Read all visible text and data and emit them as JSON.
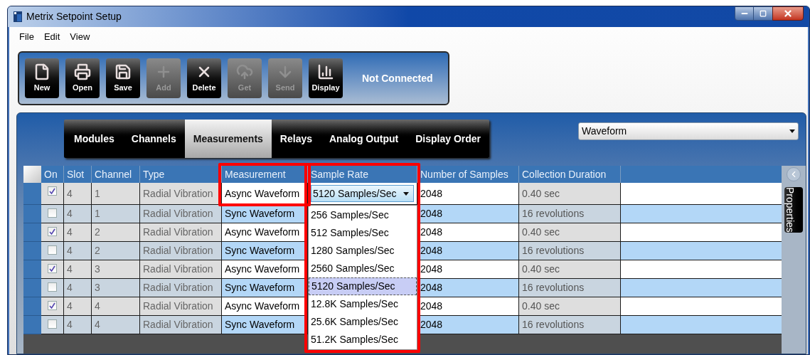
{
  "window": {
    "title": "Metrix Setpoint Setup"
  },
  "menu": [
    "File",
    "Edit",
    "View"
  ],
  "toolbar": {
    "buttons": [
      {
        "kind": "new",
        "label": "New",
        "disabled": false
      },
      {
        "kind": "open",
        "label": "Open",
        "disabled": false
      },
      {
        "kind": "save",
        "label": "Save",
        "disabled": false
      },
      {
        "kind": "add",
        "label": "Add",
        "disabled": true
      },
      {
        "kind": "delete",
        "label": "Delete",
        "disabled": false
      },
      {
        "kind": "get",
        "label": "Get",
        "disabled": true
      },
      {
        "kind": "send",
        "label": "Send",
        "disabled": true
      },
      {
        "kind": "display",
        "label": "Display",
        "disabled": false
      }
    ],
    "status": "Not Connected"
  },
  "tabs": [
    {
      "label": "Modules",
      "selected": false
    },
    {
      "label": "Channels",
      "selected": false
    },
    {
      "label": "Measurements",
      "selected": true
    },
    {
      "label": "Relays",
      "selected": false
    },
    {
      "label": "Analog Output",
      "selected": false
    },
    {
      "label": "Display Order",
      "selected": false
    }
  ],
  "filter": {
    "value": "Waveform"
  },
  "table": {
    "columns": [
      {
        "label": "On",
        "highlighted": false
      },
      {
        "label": "Slot",
        "highlighted": false
      },
      {
        "label": "Channel",
        "highlighted": false
      },
      {
        "label": "Type",
        "highlighted": false
      },
      {
        "label": "Measurement",
        "highlighted": true
      },
      {
        "label": "Sample Rate",
        "highlighted": true
      },
      {
        "label": "Number of Samples",
        "highlighted": false
      },
      {
        "label": "Collection Duration",
        "highlighted": false
      }
    ],
    "rows": [
      {
        "on": true,
        "slot": "4",
        "channel": "1",
        "type": "Radial Vibration",
        "measurement": "Async Waveform",
        "sample_rate": "5120 Samples/Sec",
        "samples": "2048",
        "duration": "0.40 sec"
      },
      {
        "on": false,
        "slot": "4",
        "channel": "1",
        "type": "Radial Vibration",
        "measurement": "Sync Waveform",
        "samples": "2048",
        "duration": "16 revolutions"
      },
      {
        "on": true,
        "slot": "4",
        "channel": "2",
        "type": "Radial Vibration",
        "measurement": "Async Waveform",
        "samples": "2048",
        "duration": "0.40 sec"
      },
      {
        "on": false,
        "slot": "4",
        "channel": "2",
        "type": "Radial Vibration",
        "measurement": "Sync Waveform",
        "samples": "2048",
        "duration": "16 revolutions"
      },
      {
        "on": true,
        "slot": "4",
        "channel": "3",
        "type": "Radial Vibration",
        "measurement": "Async Waveform",
        "samples": "2048",
        "duration": "0.40 sec"
      },
      {
        "on": false,
        "slot": "4",
        "channel": "3",
        "type": "Radial Vibration",
        "measurement": "Sync Waveform",
        "samples": "2048",
        "duration": "16 revolutions"
      },
      {
        "on": true,
        "slot": "4",
        "channel": "4",
        "type": "Radial Vibration",
        "measurement": "Async Waveform",
        "samples": "2048",
        "duration": "0.40 sec"
      },
      {
        "on": false,
        "slot": "4",
        "channel": "4",
        "type": "Radial Vibration",
        "measurement": "Sync Waveform",
        "samples": "2048",
        "duration": "16 revolutions"
      }
    ],
    "dropdown_options": [
      {
        "label": "256 Samples/Sec",
        "selected": false
      },
      {
        "label": "512 Samples/Sec",
        "selected": false
      },
      {
        "label": "1280 Samples/Sec",
        "selected": false
      },
      {
        "label": "2560 Samples/Sec",
        "selected": false
      },
      {
        "label": "5120 Samples/Sec",
        "selected": true
      },
      {
        "label": "12.8K Samples/Sec",
        "selected": false
      },
      {
        "label": "25.6K Samples/Sec",
        "selected": false
      },
      {
        "label": "51.2K Samples/Sec",
        "selected": false
      }
    ]
  },
  "side_tab": {
    "label": "Properties"
  }
}
